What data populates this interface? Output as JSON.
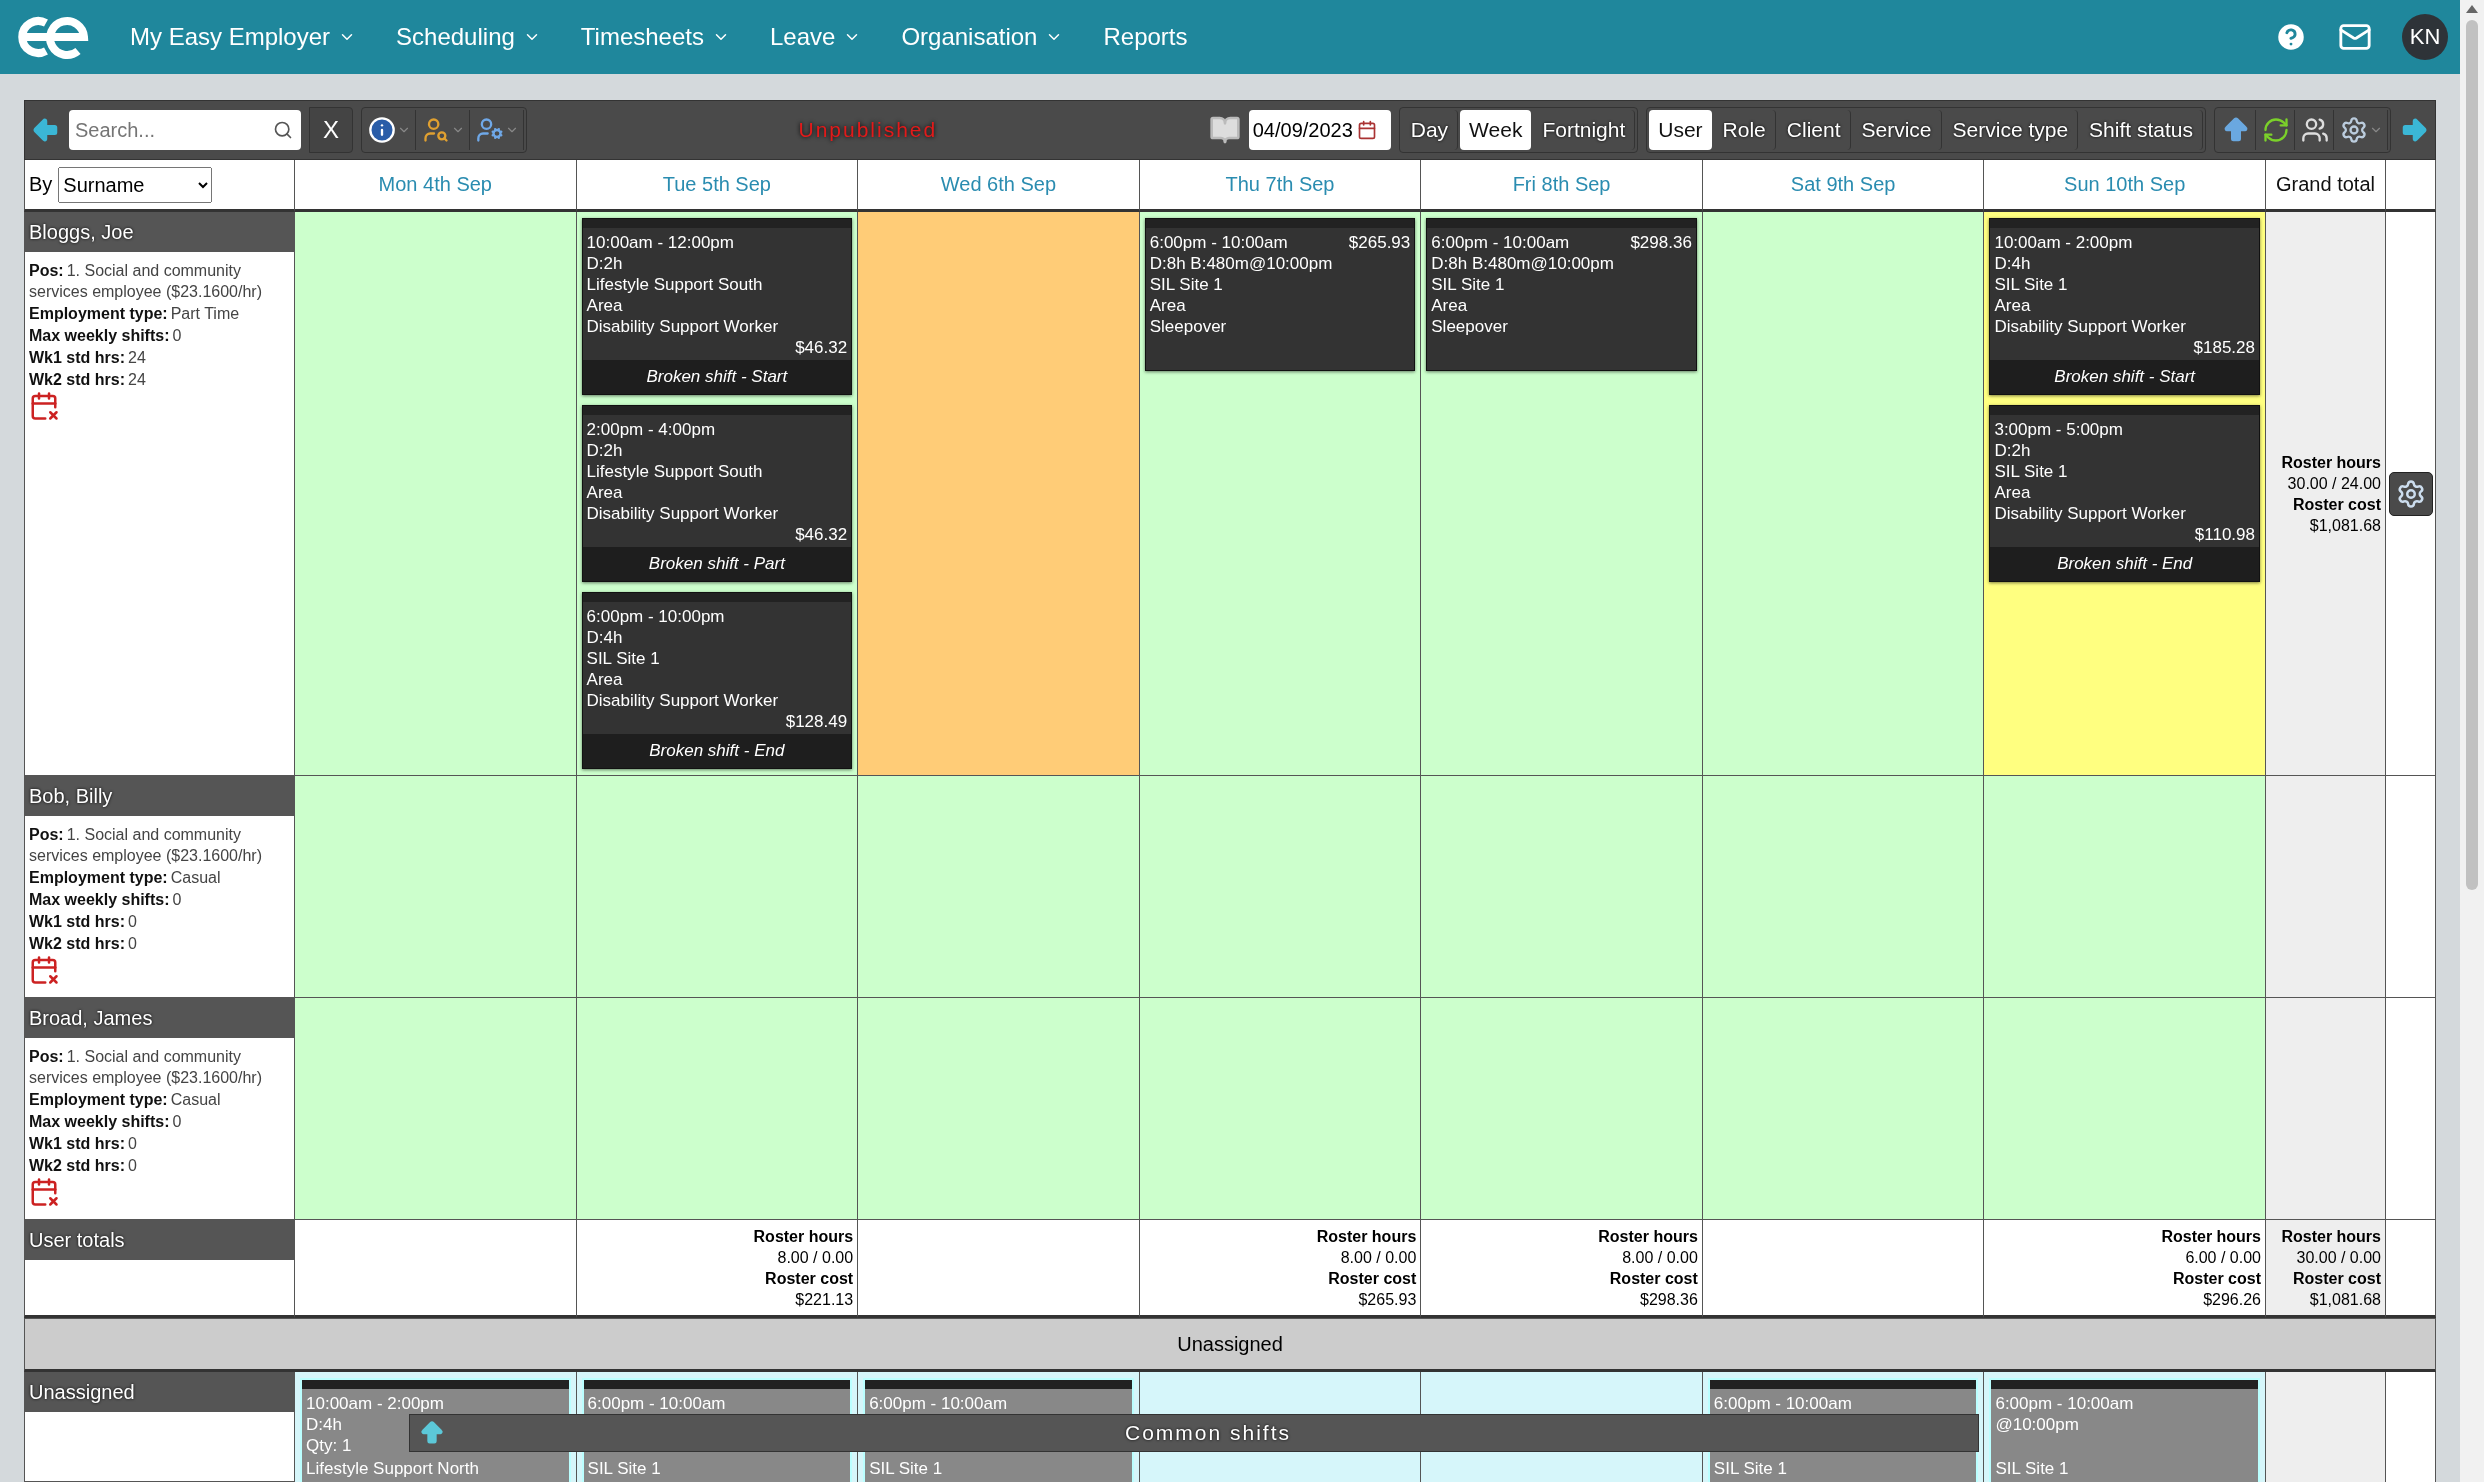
{
  "nav": {
    "items": [
      {
        "label": "My Easy Employer",
        "has_menu": true
      },
      {
        "label": "Scheduling",
        "has_menu": true
      },
      {
        "label": "Timesheets",
        "has_menu": true
      },
      {
        "label": "Leave",
        "has_menu": true
      },
      {
        "label": "Organisation",
        "has_menu": true
      },
      {
        "label": "Reports",
        "has_menu": false
      }
    ],
    "avatar": "KN"
  },
  "toolbar": {
    "search": {
      "placeholder": "Search..."
    },
    "clear": "X",
    "status": "Unpublished",
    "date": "04/09/2023",
    "views": [
      {
        "label": "Day",
        "selected": false
      },
      {
        "label": "Week",
        "selected": true
      },
      {
        "label": "Fortnight",
        "selected": false
      }
    ],
    "groupings": [
      {
        "label": "User",
        "selected": true
      },
      {
        "label": "Role",
        "selected": false
      },
      {
        "label": "Client",
        "selected": false
      },
      {
        "label": "Service",
        "selected": false
      },
      {
        "label": "Service type",
        "selected": false
      },
      {
        "label": "Shift status",
        "selected": false
      }
    ]
  },
  "sort": {
    "label": "By",
    "value": "Surname"
  },
  "days": [
    "Mon 4th Sep",
    "Tue 5th Sep",
    "Wed 6th Sep",
    "Thu 7th Sep",
    "Fri 8th Sep",
    "Sat 9th Sep",
    "Sun 10th Sep"
  ],
  "grand_total_heading": "Grand total",
  "employees": [
    {
      "name": "Bloggs, Joe",
      "details": [
        {
          "label": "Pos:",
          "value": "1. Social and community services employee ($23.1600/hr)"
        },
        {
          "label": "Employment type:",
          "value": "Part Time"
        },
        {
          "label": "Max weekly shifts:",
          "value": "0"
        },
        {
          "label": "Wk1 std hrs:",
          "value": "24"
        },
        {
          "label": "Wk2 std hrs:",
          "value": "24"
        }
      ],
      "cells": [
        {
          "color": "#ccffcc"
        },
        {
          "color": "#ccffcc",
          "shifts": [
            {
              "kind": "broken",
              "time": "10:00am - 12:00pm",
              "lines": [
                "D:2h",
                "Lifestyle Support South",
                "Area",
                "Disability Support Worker"
              ],
              "amount": "$46.32",
              "footer": "Broken shift - Start"
            },
            {
              "kind": "broken",
              "time": "2:00pm - 4:00pm",
              "lines": [
                "D:2h",
                "Lifestyle Support South",
                "Area",
                "Disability Support Worker"
              ],
              "amount": "$46.32",
              "footer": "Broken shift - Part"
            },
            {
              "kind": "broken",
              "time": "6:00pm - 10:00pm",
              "lines": [
                "D:4h",
                "SIL Site 1",
                "Area",
                "Disability Support Worker"
              ],
              "amount": "$128.49",
              "footer": "Broken shift - End"
            }
          ]
        },
        {
          "color": "#ffcc77"
        },
        {
          "color": "#ccffcc",
          "shifts": [
            {
              "kind": "sleepover",
              "time": "6:00pm - 10:00am",
              "lines": [
                "D:8h B:480m@10:00pm",
                "SIL Site 1",
                "Area",
                "Sleepover"
              ],
              "amount": "$265.93"
            }
          ]
        },
        {
          "color": "#ccffcc",
          "shifts": [
            {
              "kind": "sleepover",
              "time": "6:00pm - 10:00am",
              "lines": [
                "D:8h B:480m@10:00pm",
                "SIL Site 1",
                "Area",
                "Sleepover"
              ],
              "amount": "$298.36"
            }
          ]
        },
        {
          "color": "#ccffcc"
        },
        {
          "color": "#ffff80",
          "shifts": [
            {
              "kind": "broken",
              "time": "10:00am - 2:00pm",
              "lines": [
                "D:4h",
                "SIL Site 1",
                "Area",
                "Disability Support Worker"
              ],
              "amount": "$185.28",
              "footer": "Broken shift - Start"
            },
            {
              "kind": "broken",
              "time": "3:00pm - 5:00pm",
              "lines": [
                "D:2h",
                "SIL Site 1",
                "Area",
                "Disability Support Worker"
              ],
              "amount": "$110.98",
              "footer": "Broken shift - End"
            }
          ]
        }
      ],
      "totals": {
        "hours_label": "Roster hours",
        "hours": "30.00 / 24.00",
        "cost_label": "Roster cost",
        "cost": "$1,081.68"
      }
    },
    {
      "name": "Bob, Billy",
      "details": [
        {
          "label": "Pos:",
          "value": "1. Social and community services employee ($23.1600/hr)"
        },
        {
          "label": "Employment type:",
          "value": "Casual"
        },
        {
          "label": "Max weekly shifts:",
          "value": "0"
        },
        {
          "label": "Wk1 std hrs:",
          "value": "0"
        },
        {
          "label": "Wk2 std hrs:",
          "value": "0"
        }
      ],
      "cells": [
        {
          "color": "#ccffcc"
        },
        {
          "color": "#ccffcc"
        },
        {
          "color": "#ccffcc"
        },
        {
          "color": "#ccffcc"
        },
        {
          "color": "#ccffcc"
        },
        {
          "color": "#ccffcc"
        },
        {
          "color": "#ccffcc"
        }
      ]
    },
    {
      "name": "Broad, James",
      "details": [
        {
          "label": "Pos:",
          "value": "1. Social and community services employee ($23.1600/hr)"
        },
        {
          "label": "Employment type:",
          "value": "Casual"
        },
        {
          "label": "Max weekly shifts:",
          "value": "0"
        },
        {
          "label": "Wk1 std hrs:",
          "value": "0"
        },
        {
          "label": "Wk2 std hrs:",
          "value": "0"
        }
      ],
      "cells": [
        {
          "color": "#ccffcc"
        },
        {
          "color": "#ccffcc"
        },
        {
          "color": "#ccffcc"
        },
        {
          "color": "#ccffcc"
        },
        {
          "color": "#ccffcc"
        },
        {
          "color": "#ccffcc"
        },
        {
          "color": "#ccffcc"
        }
      ]
    }
  ],
  "user_totals": {
    "label": "User totals",
    "cells": [
      {},
      {
        "hours_label": "Roster hours",
        "hours": "8.00 / 0.00",
        "cost_label": "Roster cost",
        "cost": "$221.13"
      },
      {},
      {
        "hours_label": "Roster hours",
        "hours": "8.00 / 0.00",
        "cost_label": "Roster cost",
        "cost": "$265.93"
      },
      {
        "hours_label": "Roster hours",
        "hours": "8.00 / 0.00",
        "cost_label": "Roster cost",
        "cost": "$298.36"
      },
      {},
      {
        "hours_label": "Roster hours",
        "hours": "6.00 / 0.00",
        "cost_label": "Roster cost",
        "cost": "$296.26"
      }
    ],
    "grand": {
      "hours_label": "Roster hours",
      "hours": "30.00 / 0.00",
      "cost_label": "Roster cost",
      "cost": "$1,081.68"
    }
  },
  "unassigned_band": "Unassigned",
  "unassigned": {
    "label": "Unassigned",
    "common_shifts": "Common shifts",
    "cells": [
      {
        "shift": {
          "time": "10:00am - 2:00pm",
          "mid": [
            "D:4h",
            "Qty: 1"
          ],
          "lines": [
            "Lifestyle Support North"
          ]
        }
      },
      {
        "shift": {
          "time": "6:00pm - 10:00am",
          "lines": [
            "SIL Site 1"
          ]
        }
      },
      {
        "shift": {
          "time": "6:00pm - 10:00am",
          "lines": [
            "SIL Site 1"
          ]
        }
      },
      {},
      {},
      {
        "shift": {
          "time": "6:00pm - 10:00am",
          "lines": [
            "SIL Site 1"
          ]
        }
      },
      {
        "shift": {
          "time": "6:00pm - 10:00am",
          "mid": [
            "@10:00pm"
          ],
          "lines": [
            "SIL Site 1"
          ]
        }
      }
    ]
  }
}
